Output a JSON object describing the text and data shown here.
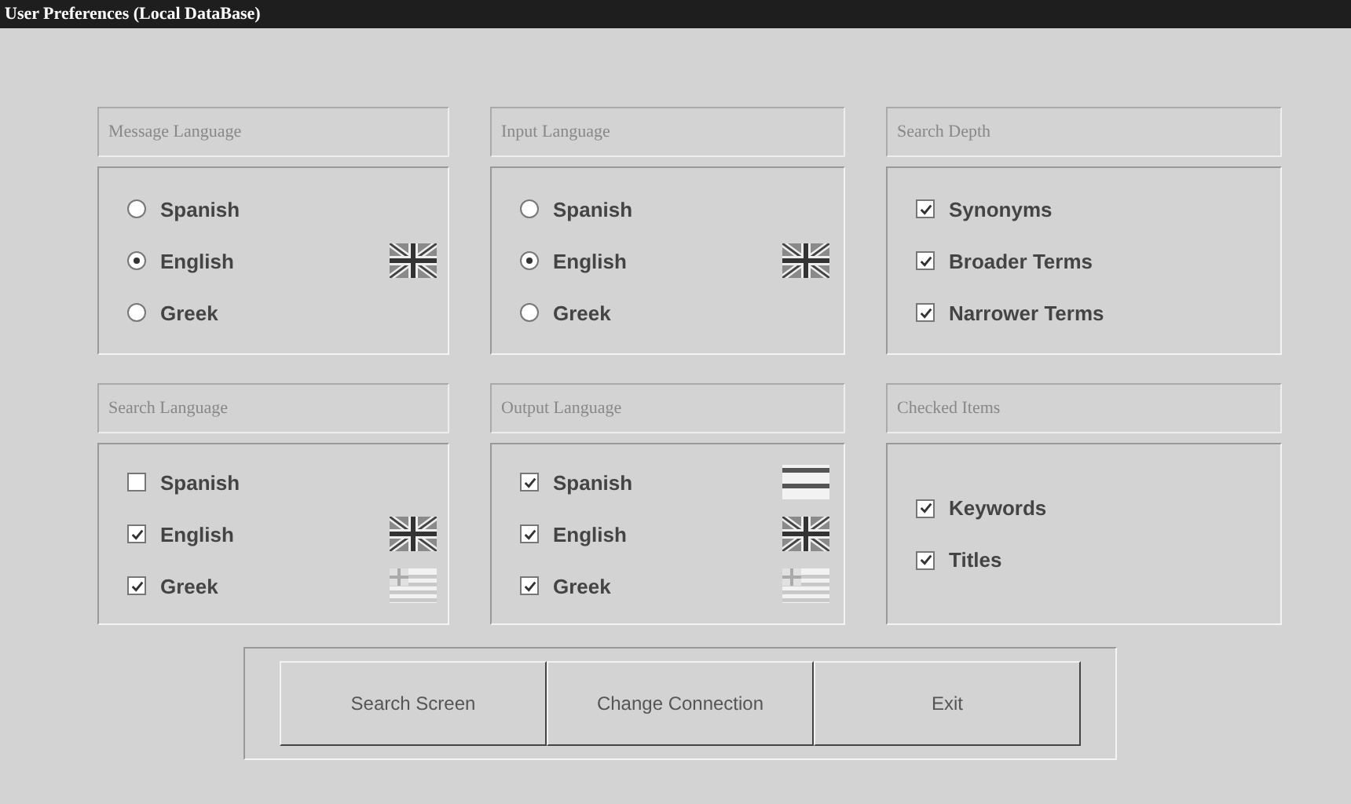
{
  "window": {
    "title": "User Preferences (Local DataBase)"
  },
  "groups": [
    {
      "title": "Message Language",
      "kind": "radio",
      "items": [
        {
          "label": "Spanish",
          "selected": false
        },
        {
          "label": "English",
          "selected": true,
          "flag": {
            "kind": "english"
          }
        },
        {
          "label": "Greek",
          "selected": false
        }
      ]
    },
    {
      "title": "Input Language",
      "kind": "radio",
      "items": [
        {
          "label": "Spanish",
          "selected": false
        },
        {
          "label": "English",
          "selected": true,
          "flag": {
            "kind": "english"
          }
        },
        {
          "label": "Greek",
          "selected": false
        }
      ]
    },
    {
      "title": "Search Depth",
      "kind": "check",
      "items": [
        {
          "label": "Synonyms",
          "checked": true
        },
        {
          "label": "Broader Terms",
          "checked": true
        },
        {
          "label": "Narrower Terms",
          "checked": true
        }
      ]
    },
    {
      "title": "Search Language",
      "kind": "check",
      "items": [
        {
          "label": "Spanish",
          "checked": false
        },
        {
          "label": "English",
          "checked": true,
          "flag": {
            "kind": "english"
          }
        },
        {
          "label": "Greek",
          "checked": true,
          "flag": {
            "kind": "greek"
          }
        }
      ]
    },
    {
      "title": "Output Language",
      "kind": "check",
      "items": [
        {
          "label": "Spanish",
          "checked": true,
          "flag": {
            "kind": "spanish"
          }
        },
        {
          "label": "English",
          "checked": true,
          "flag": {
            "kind": "english"
          }
        },
        {
          "label": "Greek",
          "checked": true,
          "flag": {
            "kind": "greek"
          }
        }
      ]
    },
    {
      "title": "Checked Items",
      "kind": "check",
      "items": [
        {
          "label": "Keywords",
          "checked": true
        },
        {
          "label": "Titles",
          "checked": true
        }
      ]
    }
  ],
  "buttons": [
    "Search Screen",
    "Change Connection",
    "Exit"
  ]
}
